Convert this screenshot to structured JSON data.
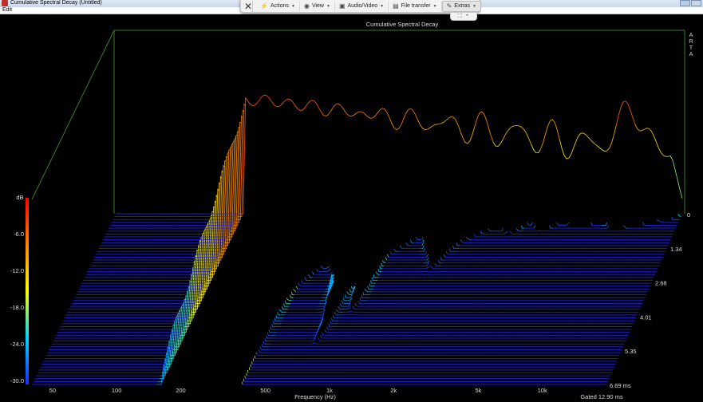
{
  "window": {
    "title": "Cumulative Spectral Decay  (Untitled)",
    "menu": [
      "Edit"
    ]
  },
  "remote_toolbar": {
    "close_icon": "close-icon",
    "items": [
      {
        "label": "Actions",
        "icon": "lightning-icon"
      },
      {
        "label": "View",
        "icon": "eye-icon"
      },
      {
        "label": "Audio/Video",
        "icon": "speaker-icon"
      },
      {
        "label": "File transfer",
        "icon": "file-icon"
      },
      {
        "label": "Extras",
        "icon": "tools-icon"
      }
    ]
  },
  "chart_data": {
    "type": "waterfall",
    "title": "Cumulative Spectral Decay",
    "watermark": "ARTA",
    "xlabel": "Frequency (Hz)",
    "x_scale": "log",
    "xlim": [
      40,
      20000
    ],
    "x_ticks": [
      {
        "value": 50,
        "label": "50"
      },
      {
        "value": 100,
        "label": "100"
      },
      {
        "value": 200,
        "label": "200"
      },
      {
        "value": 500,
        "label": "500"
      },
      {
        "value": 1000,
        "label": "1k"
      },
      {
        "value": 2000,
        "label": "2k"
      },
      {
        "value": 5000,
        "label": "5k"
      },
      {
        "value": 10000,
        "label": "10k"
      }
    ],
    "z_unit": "dB",
    "zlim": [
      -30,
      0
    ],
    "z_ticks": [
      "-6.0",
      "-12.0",
      "-18.0",
      "-24.0",
      "-30.0"
    ],
    "time_ticks": [
      "0",
      "1.34",
      "2.68",
      "4.01",
      "5.35",
      "6.69 ms"
    ],
    "time_range_ms": [
      0,
      6.69
    ],
    "slices": 60,
    "gate_label": "Gated 12.90 ms",
    "colormap": [
      "#2222ff",
      "#00d8ff",
      "#ffff00",
      "#ff8800",
      "#ff0000"
    ],
    "background": "#000000",
    "frame_color": "#3a7d2a"
  }
}
